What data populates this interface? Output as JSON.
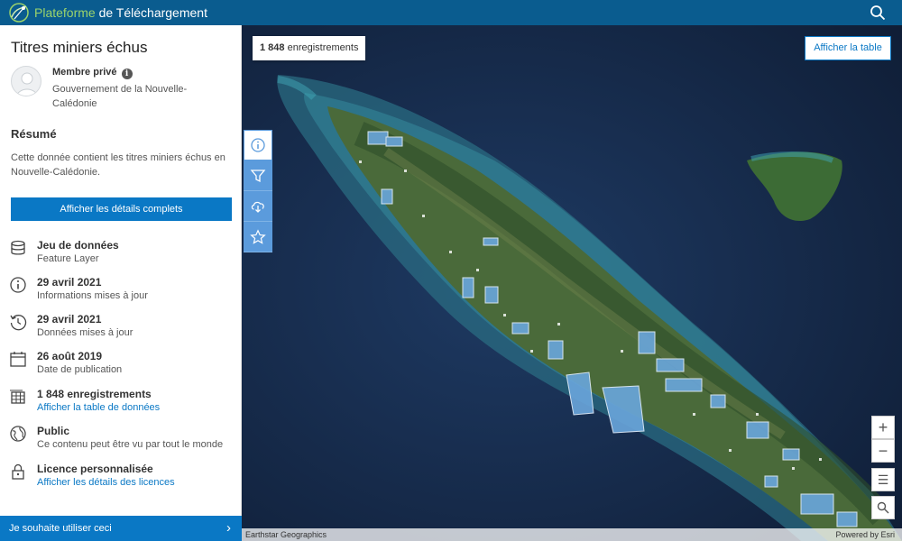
{
  "header": {
    "brand_part1": "Plateforme",
    "brand_part2": " de Téléchargement",
    "bar_color": "#0a5c8f"
  },
  "sidebar": {
    "title": "Titres miniers échus",
    "owner": {
      "name": "Membre privé",
      "org": "Gouvernement de la Nouvelle-Calédonie"
    },
    "summary_heading": "Résumé",
    "summary_text": "Cette donnée contient les titres miniers échus en Nouvelle-Calédonie.",
    "details_button": "Afficher les détails complets",
    "meta": [
      {
        "icon": "database-icon",
        "key": "Jeu de données",
        "value": "Feature Layer"
      },
      {
        "icon": "info-icon",
        "key": "29 avril 2021",
        "value": "Informations mises à jour"
      },
      {
        "icon": "history-icon",
        "key": "29 avril 2021",
        "value": "Données mises à jour"
      },
      {
        "icon": "calendar-icon",
        "key": "26 août 2019",
        "value": "Date de publication"
      },
      {
        "icon": "table-icon",
        "key": "1 848 enregistrements",
        "value": "Afficher la table de données"
      },
      {
        "icon": "globe-icon",
        "key": "Public",
        "value": "Ce contenu peut être vu par tout le monde"
      },
      {
        "icon": "lock-icon",
        "key": "Licence personnalisée",
        "value": "Afficher les détails des licences"
      }
    ],
    "use_button": "Je souhaite utiliser ceci",
    "accent": "#0a78c5"
  },
  "map": {
    "count": "1 848",
    "count_suffix": " enregistrements",
    "table_button": "Afficher la table",
    "tools": [
      "info-icon",
      "filter-icon",
      "download-icon",
      "star-icon"
    ],
    "attribution": "Earthstar Geographics",
    "powered_by": "Powered by Esri"
  }
}
